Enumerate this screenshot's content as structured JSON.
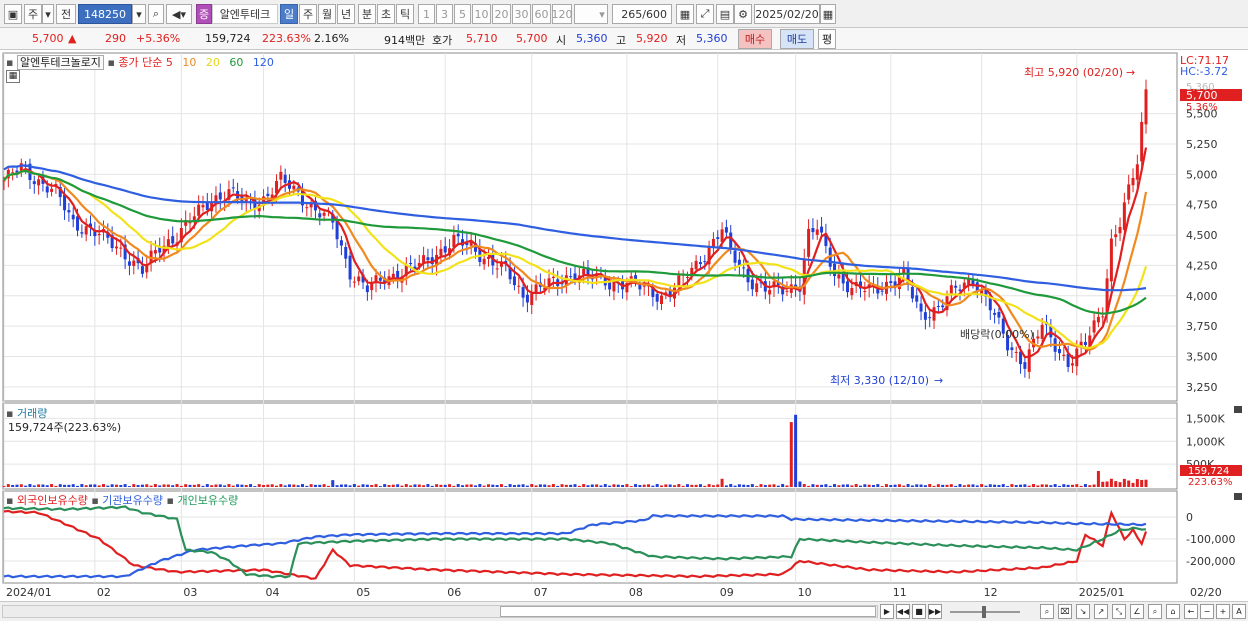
{
  "toolbar": {
    "market": "주",
    "market_prefix": "전",
    "code": "148250",
    "stock_name": "알엔투테크",
    "stock_badge": "증",
    "periods": [
      "일",
      "주",
      "월",
      "년",
      "분",
      "초",
      "틱"
    ],
    "selected_period": "일",
    "intervals": [
      "1",
      "3",
      "5",
      "10",
      "20",
      "30",
      "60",
      "120"
    ],
    "count": "265",
    "count_max": "/600",
    "date": "2025/02/20"
  },
  "quote": {
    "price": "5,700",
    "arrow": "▲",
    "change": "290",
    "change_pct": "+5.36%",
    "volume": "159,724",
    "volume_ratio": "223.63%",
    "turnover": "2.16%",
    "amount": "914백만",
    "bid_label": "호가",
    "bid": "5,710",
    "ask": "5,700",
    "open_label": "시",
    "open": "5,360",
    "high_label": "고",
    "high": "5,920",
    "low_label": "저",
    "low": "5,360",
    "buy_label": "매수",
    "sell_label": "매도",
    "avg_label": "평"
  },
  "price_pane": {
    "name_label": "알엔투테크놀로지",
    "ma_label": "종가 단순",
    "ma_periods": [
      "5",
      "10",
      "20",
      "60",
      "120"
    ],
    "ma_colors": [
      "#e02020",
      "#f08a1e",
      "#f2e21a",
      "#1f9a3a",
      "#2f5fe0"
    ],
    "lc": "LC:71.17",
    "hc": "HC:-3.72",
    "max_annot": "최고 5,920 (02/20)",
    "min_annot": "최저 3,330 (12/10)",
    "drop_annot": "배당락(0.00%)",
    "price_tag": "5,700",
    "pct_tag": "5.36%",
    "prev_tag": "5,360",
    "y_ticks": [
      "5,500",
      "5,250",
      "5,000",
      "4,750",
      "4,500",
      "4,250",
      "4,000",
      "3,750",
      "3,500",
      "3,250"
    ]
  },
  "volume_pane": {
    "label": "거래량",
    "value": "159,724주(223.63%)",
    "y_ticks": [
      "1,500K",
      "1,000K",
      "500K"
    ],
    "tag": "159,724",
    "tag_pct": "223.63%"
  },
  "holdings_pane": {
    "labels": [
      "외국인보유수량",
      "기관보유수량",
      "개인보유수량"
    ],
    "colors": [
      "#e02020",
      "#2f5fe0",
      "#1f9a5a"
    ],
    "y_ticks": [
      "0",
      "-100,000",
      "-200,000"
    ]
  },
  "x_axis": [
    "2024/01",
    "02",
    "03",
    "04",
    "05",
    "06",
    "07",
    "08",
    "09",
    "10",
    "11",
    "12",
    "2025/01",
    "02",
    "02/20"
  ],
  "chart_data": {
    "type": "line",
    "title": "알엔투테크놀로지",
    "ylim": [
      3250,
      5920
    ],
    "x": [
      "2024/01",
      "02",
      "03",
      "04",
      "05",
      "06",
      "07",
      "08",
      "09",
      "10",
      "11",
      "12",
      "2025/01",
      "02"
    ],
    "series": [
      {
        "name": "5",
        "values": [
          4950,
          4550,
          4300,
          4800,
          4150,
          4450,
          4150,
          4100,
          4500,
          4450,
          4050,
          3600,
          3950,
          5550
        ]
      },
      {
        "name": "120",
        "values": [
          5200,
          4950,
          4800,
          4700,
          4680,
          4550,
          4450,
          4350,
          4280,
          4220,
          4150,
          4080,
          4000,
          4150
        ]
      }
    ],
    "annotations": [
      "최고 5,920 (02/20)",
      "최저 3,330 (12/10)"
    ]
  }
}
